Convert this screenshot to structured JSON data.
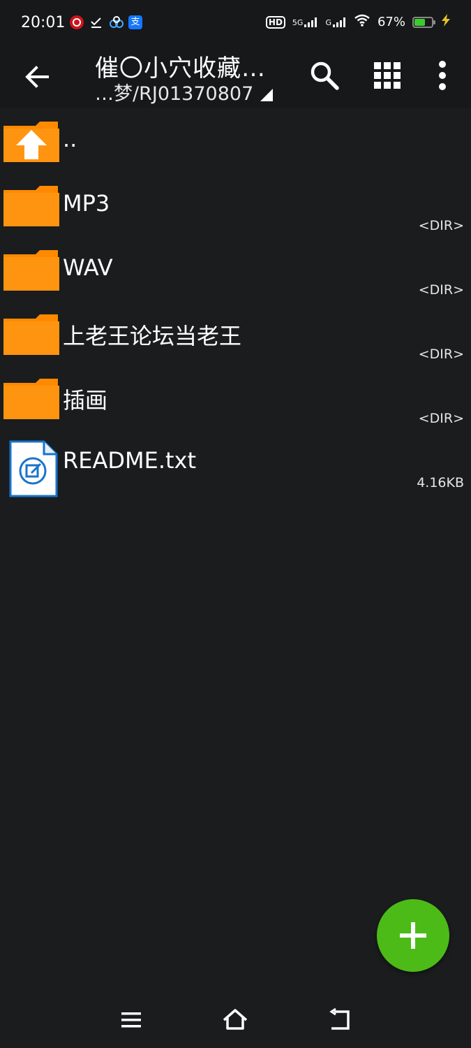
{
  "status_bar": {
    "time": "20:01",
    "app_icons": [
      "netease-music-icon",
      "tasks-icon",
      "baidu-netdisk-icon",
      "alipay-icon"
    ],
    "alipay_glyph": "支",
    "hd_label": "HD",
    "net1": "5G",
    "net2": "G",
    "battery_percent": "67%",
    "battery_level": 0.67,
    "colors": {
      "battery": "#3ecb2f",
      "charging": "#e6c229"
    }
  },
  "toolbar": {
    "title": "催〇小穴收藏…",
    "path": "…梦/RJ01370807",
    "icons": [
      "back-arrow-icon",
      "search-icon",
      "grid-view-icon",
      "more-vert-icon"
    ]
  },
  "files": [
    {
      "name": "..",
      "meta": "",
      "type": "parent"
    },
    {
      "name": "MP3",
      "meta": "<DIR>",
      "type": "folder"
    },
    {
      "name": "WAV",
      "meta": "<DIR>",
      "type": "folder"
    },
    {
      "name": "上老王论坛当老王",
      "meta": "<DIR>",
      "type": "folder"
    },
    {
      "name": "插画",
      "meta": "<DIR>",
      "type": "folder"
    },
    {
      "name": "README.txt",
      "meta": "4.16KB",
      "type": "text-file"
    }
  ],
  "fab": {
    "icon": "plus-icon",
    "color": "#4cbb17"
  },
  "nav": {
    "icons": [
      "menu-icon",
      "home-icon",
      "back-icon"
    ]
  },
  "colors": {
    "folder": "#ff8a00",
    "background": "#1a1c1e",
    "file_blue": "#1a73c9"
  }
}
